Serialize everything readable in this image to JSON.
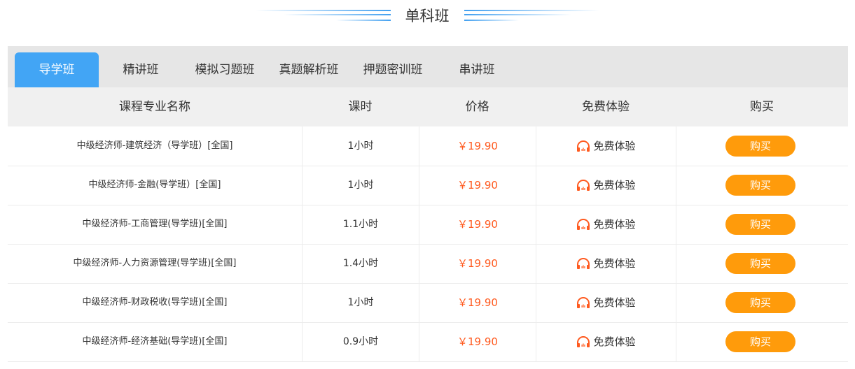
{
  "section_title": "单科班",
  "tabs": [
    {
      "label": "导学班",
      "active": true
    },
    {
      "label": "精讲班",
      "active": false
    },
    {
      "label": "模拟习题班",
      "active": false
    },
    {
      "label": "真题解析班",
      "active": false
    },
    {
      "label": "押题密训班",
      "active": false
    },
    {
      "label": "串讲班",
      "active": false
    }
  ],
  "table": {
    "headers": [
      "课程专业名称",
      "课时",
      "价格",
      "免费体验",
      "购买"
    ],
    "rows": [
      {
        "name": "中级经济师-建筑经济（导学班）[全国]",
        "hours": "1小时",
        "price": "￥19.90",
        "trial": "免费体验",
        "buy": "购买"
      },
      {
        "name": "中级经济师-金融(导学班）[全国]",
        "hours": "1小时",
        "price": "￥19.90",
        "trial": "免费体验",
        "buy": "购买"
      },
      {
        "name": "中级经济师-工商管理(导学班)[全国]",
        "hours": "1.1小时",
        "price": "￥19.90",
        "trial": "免费体验",
        "buy": "购买"
      },
      {
        "name": "中级经济师-人力资源管理(导学班)[全国]",
        "hours": "1.4小时",
        "price": "￥19.90",
        "trial": "免费体验",
        "buy": "购买"
      },
      {
        "name": "中级经济师-财政税收(导学班)[全国]",
        "hours": "1小时",
        "price": "￥19.90",
        "trial": "免费体验",
        "buy": "购买"
      },
      {
        "name": "中级经济师-经济基础(导学班)[全国]",
        "hours": "0.9小时",
        "price": "￥19.90",
        "trial": "免费体验",
        "buy": "购买"
      }
    ]
  },
  "colors": {
    "accent_blue": "#42a5f5",
    "price_orange": "#ff5a1f",
    "buy_button": "#ff9b0b",
    "headphone_icon": "#ff5a1f"
  },
  "icons": {
    "trial": "headphones-icon"
  }
}
